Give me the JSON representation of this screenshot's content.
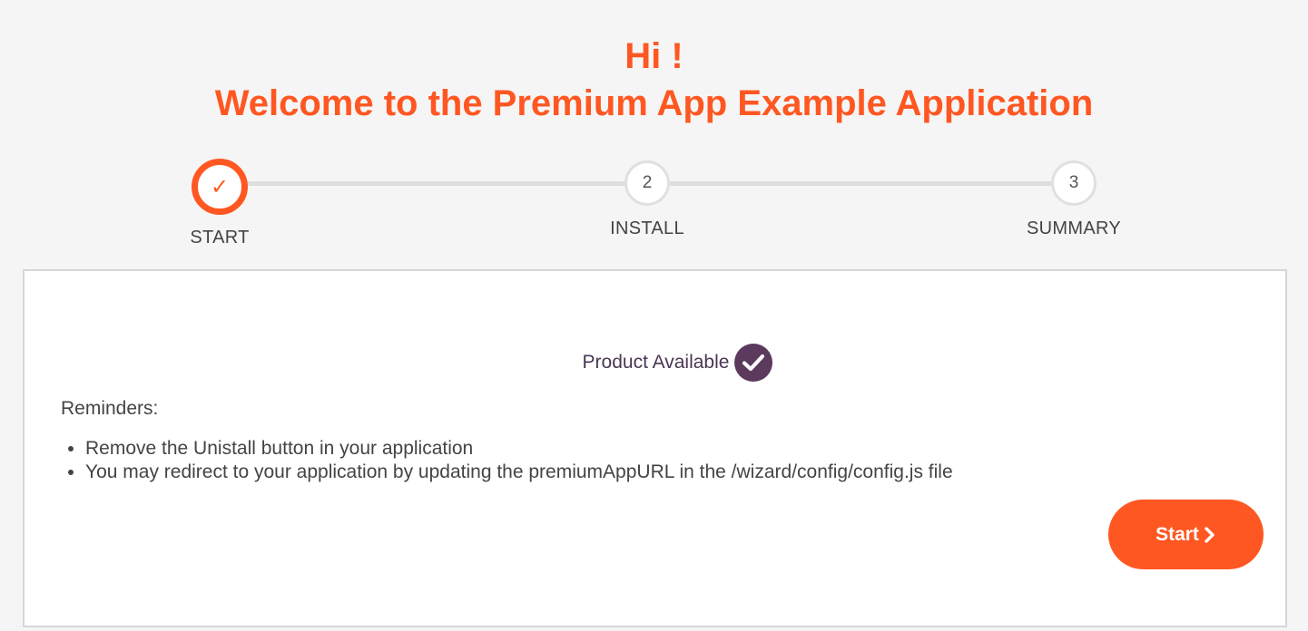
{
  "header": {
    "greeting": "Hi !",
    "welcome": "Welcome to the Premium App Example Application"
  },
  "stepper": {
    "steps": [
      {
        "marker": "✓",
        "label": "START",
        "state": "done"
      },
      {
        "marker": "2",
        "label": "INSTALL",
        "state": "pending"
      },
      {
        "marker": "3",
        "label": "SUMMARY",
        "state": "pending"
      }
    ]
  },
  "panel": {
    "product_status": "Product Available",
    "status_icon": "check-circle-icon",
    "reminders_title": "Reminders:",
    "reminders": [
      "Remove the Unistall button in your application",
      "You may redirect to your application by updating the premiumAppURL in the /wizard/config/config.js file"
    ],
    "start_button": "Start",
    "start_button_icon": "chevron-right-icon"
  },
  "colors": {
    "accent": "#ff5722",
    "status_badge": "#5b3a5e",
    "background": "#f5f5f5"
  }
}
